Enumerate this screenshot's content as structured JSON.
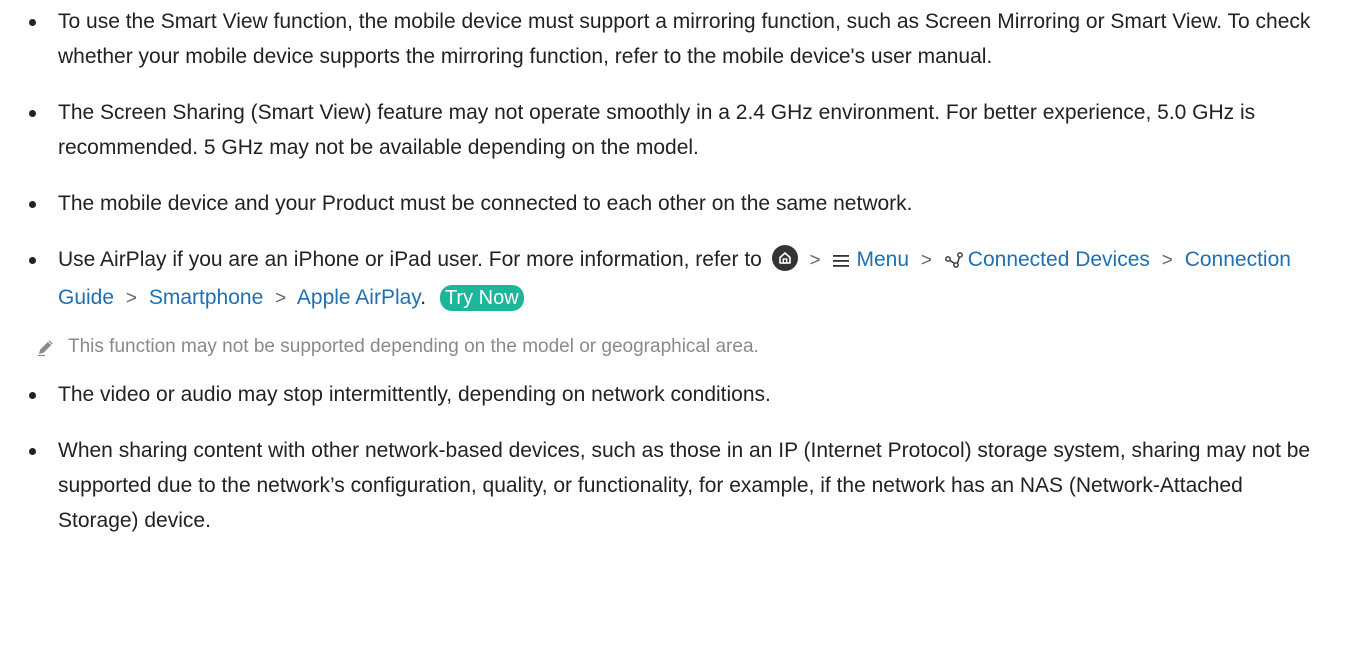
{
  "bullets": [
    {
      "text": "To use the Smart View function, the mobile device must support a mirroring function, such as Screen Mirroring or Smart View. To check whether your mobile device supports the mirroring function, refer to the mobile device's user manual."
    },
    {
      "text": "The Screen Sharing (Smart View) feature may not operate smoothly in a 2.4 GHz environment. For better experience, 5.0 GHz is recommended. 5 GHz may not be available depending on the model."
    },
    {
      "text": "The mobile device and your Product must be connected to each other on the same network."
    },
    {
      "intro": "Use AirPlay if you are an iPhone or iPad user. For more information, refer to",
      "path": {
        "home_icon": "home-icon",
        "menu": "Menu",
        "connected_devices": "Connected Devices",
        "connection_guide": "Connection Guide",
        "smartphone": "Smartphone",
        "apple_airplay": "Apple AirPlay"
      },
      "separator": ">",
      "period": ".",
      "try_now": "Try Now",
      "note": "This function may not be supported depending on the model or geographical area."
    },
    {
      "text": "The video or audio may stop intermittently, depending on network conditions."
    },
    {
      "text": "When sharing content with other network-based devices, such as those in an IP (Internet Protocol) storage system, sharing may not be supported due to the network’s configuration, quality, or functionality, for example, if the network has an NAS (Network-Attached Storage) device."
    }
  ],
  "colors": {
    "text": "#222222",
    "link": "#1f6fb2",
    "try_now_bg": "#1fb59a",
    "note_text": "#8a8a8a"
  }
}
